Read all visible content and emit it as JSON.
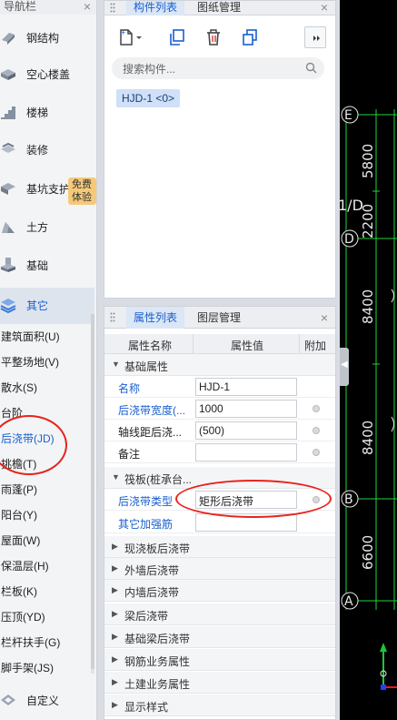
{
  "nav": {
    "title": "导航栏",
    "close": "×",
    "badge": "免费体验",
    "items": [
      {
        "label": "钢结构",
        "icon": "steel-structure-icon"
      },
      {
        "label": "空心楼盖",
        "icon": "hollow-floor-icon"
      },
      {
        "label": "楼梯",
        "icon": "stairs-icon"
      },
      {
        "label": "装修",
        "icon": "decoration-icon"
      },
      {
        "label": "基坑支护",
        "icon": "excavation-support-icon"
      },
      {
        "label": "土方",
        "icon": "earthwork-icon"
      },
      {
        "label": "基础",
        "icon": "foundation-icon"
      },
      {
        "label": "其它",
        "icon": "other-icon"
      }
    ],
    "subitems": [
      "建筑面积(U)",
      "平整场地(V)",
      "散水(S)",
      "台阶",
      "后浇带(JD)",
      "挑檐(T)",
      "雨蓬(P)",
      "阳台(Y)",
      "屋面(W)",
      "保温层(H)",
      "栏板(K)",
      "压顶(YD)",
      "栏杆扶手(G)",
      "脚手架(JS)"
    ],
    "footer": {
      "label": "自定义",
      "icon": "custom-icon"
    }
  },
  "component_panel": {
    "tabs": [
      "构件列表",
      "图纸管理"
    ],
    "close": "×",
    "search_placeholder": "搜索构件...",
    "items": [
      "HJD-1 <0>"
    ]
  },
  "property_panel": {
    "tabs": [
      "属性列表",
      "图层管理"
    ],
    "close": "×",
    "columns": [
      "属性名称",
      "属性值",
      "附加"
    ],
    "group_basic": "基础属性",
    "rows_basic": [
      {
        "name": "名称",
        "value": "HJD-1"
      },
      {
        "name": "后浇带宽度(...",
        "value": "1000"
      },
      {
        "name": "轴线距后浇...",
        "value": "(500)"
      },
      {
        "name": "备注",
        "value": ""
      }
    ],
    "group_raft": "筏板(桩承台...",
    "rows_raft": [
      {
        "name": "后浇带类型",
        "value": "矩形后浇带"
      },
      {
        "name": "其它加强筋",
        "value": ""
      }
    ],
    "collapsed_groups": [
      "现浇板后浇带",
      "外墙后浇带",
      "内墙后浇带",
      "梁后浇带",
      "基础梁后浇带",
      "钢筋业务属性",
      "土建业务属性",
      "显示样式"
    ]
  },
  "canvas": {
    "axis_labels": [
      "E",
      "1/D",
      "D",
      "B",
      "A"
    ],
    "dimensions": [
      "5800",
      "2200",
      "8400",
      "8400",
      "6600"
    ],
    "colors": {
      "green": "#1fd43a",
      "white": "#e8e8e8",
      "axis_x": "#e31b1b",
      "axis_y": "#1ac832",
      "axis_z": "#2a3cff"
    }
  },
  "colors": {
    "accent": "#1a5fcf",
    "annotation": "#e8231d"
  }
}
